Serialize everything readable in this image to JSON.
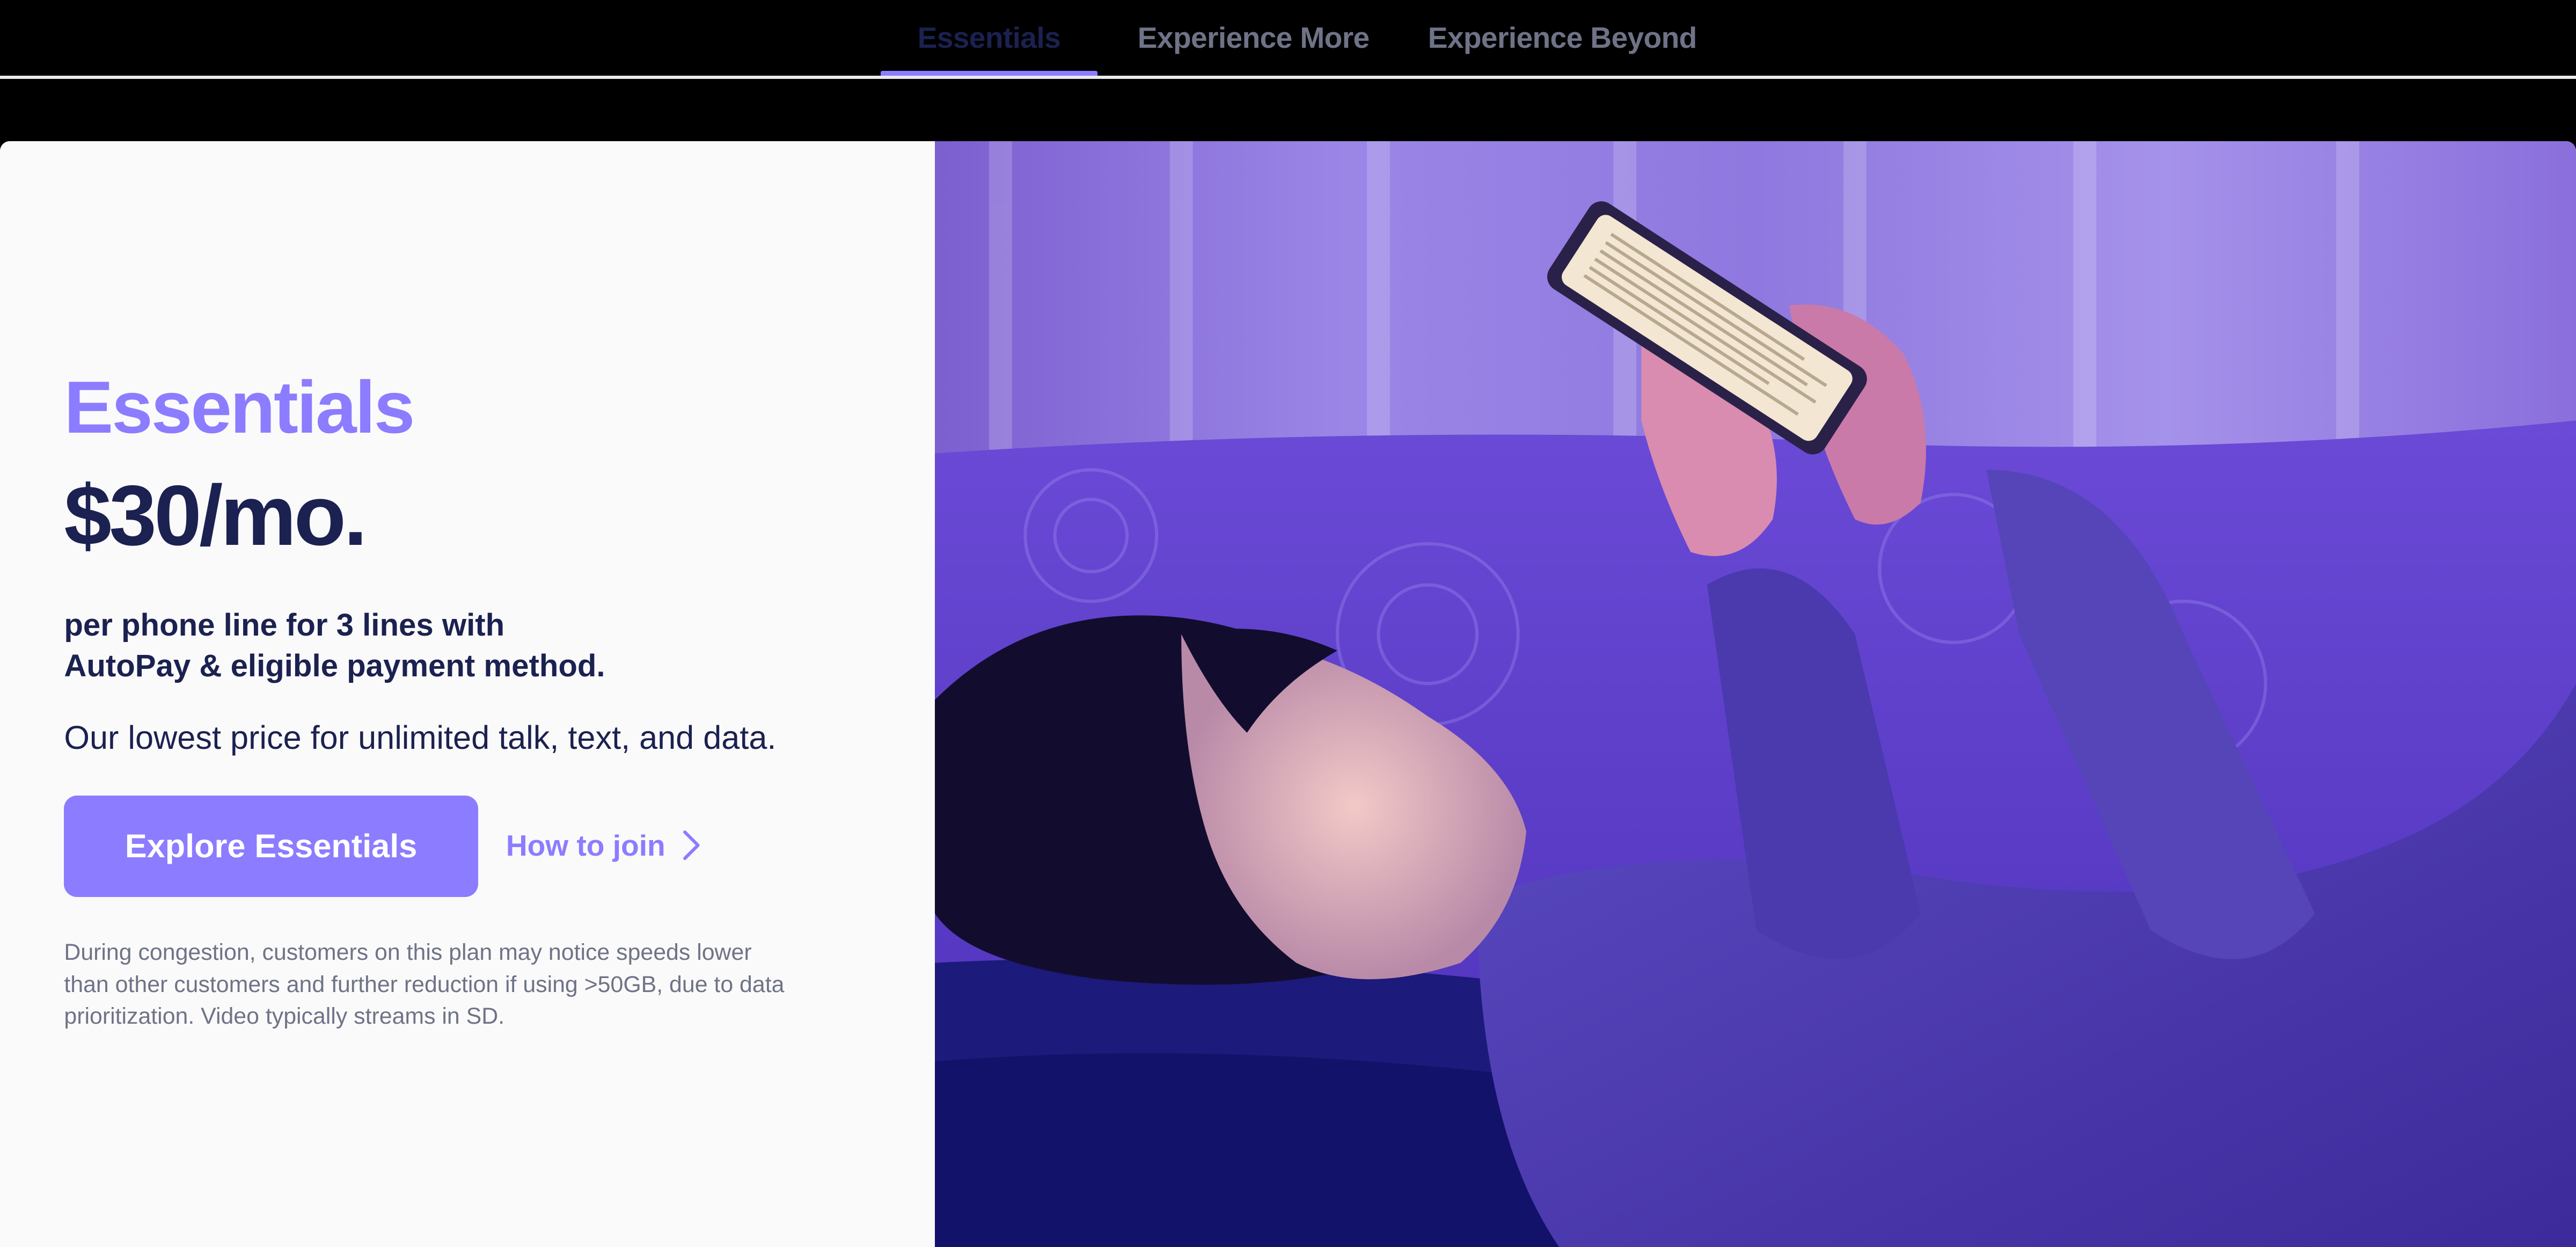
{
  "tabs": [
    {
      "label": "Essentials",
      "active": true
    },
    {
      "label": "Experience More",
      "active": false
    },
    {
      "label": "Experience Beyond",
      "active": false
    }
  ],
  "plan": {
    "name": "Essentials",
    "price": "$30/mo.",
    "subtitle_line1": "per phone line for 3 lines with",
    "subtitle_line2": "AutoPay & eligible payment method.",
    "description": "Our lowest price for unlimited talk, text, and data.",
    "cta_label": "Explore Essentials",
    "secondary_link": "How to join",
    "disclaimer": "During congestion, customers on this plan may notice speeds lower than other customers and further reduction if using >50GB, due to data prioritization. Video typically streams in SD."
  },
  "colors": {
    "accent": "#8c7cff",
    "navy": "#1b2150",
    "gray_text": "#6f7387",
    "panel_bg": "#fafafa"
  },
  "hero_image": {
    "icon": "photo-person-reading-phone-on-couch"
  }
}
